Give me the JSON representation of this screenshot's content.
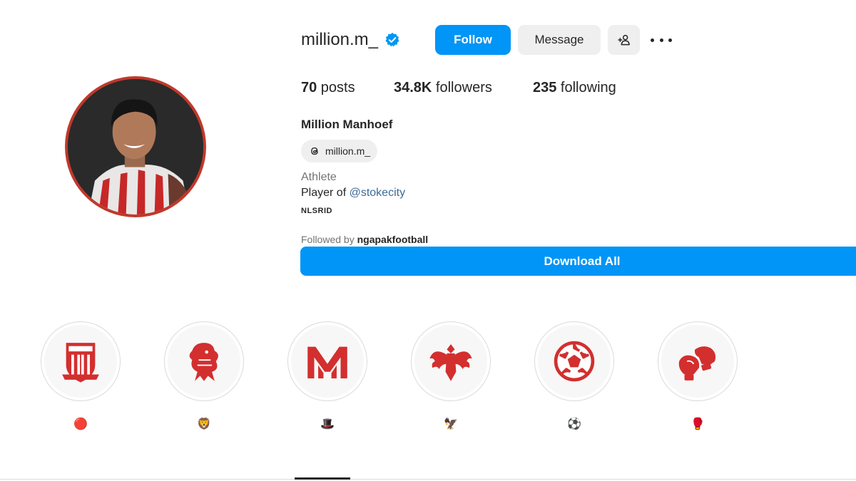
{
  "profile": {
    "username": "million.m_",
    "follow_label": "Follow",
    "message_label": "Message",
    "full_name": "Million Manhoef",
    "threads_handle": "million.m_",
    "category": "Athlete",
    "bio_prefix": "Player of ",
    "bio_mention": "@stokecity",
    "bio_tag": "NLSRID",
    "followed_by_prefix": "Followed by ",
    "followed_by_user": "ngapakfootball"
  },
  "stats": {
    "posts_count": "70",
    "posts_label": " posts",
    "followers_count": "34.8K",
    "followers_label": " followers",
    "following_count": "235",
    "following_label": " following"
  },
  "download_label": "Download All",
  "highlights": [
    {
      "icon": "stoke-city-crest-icon",
      "label": "🔴"
    },
    {
      "icon": "lion-crest-icon",
      "label": "🦁"
    },
    {
      "icon": "mm-monogram-icon",
      "label": "🎩"
    },
    {
      "icon": "eagle-crest-icon",
      "label": "🦅"
    },
    {
      "icon": "football-icon",
      "label": "⚽"
    },
    {
      "icon": "boxing-gloves-icon",
      "label": "🥊"
    }
  ],
  "colors": {
    "accent": "#0095f6",
    "highlight_red": "#d32f2f",
    "ring": "#c0392b",
    "mention": "#3e6a9a"
  }
}
